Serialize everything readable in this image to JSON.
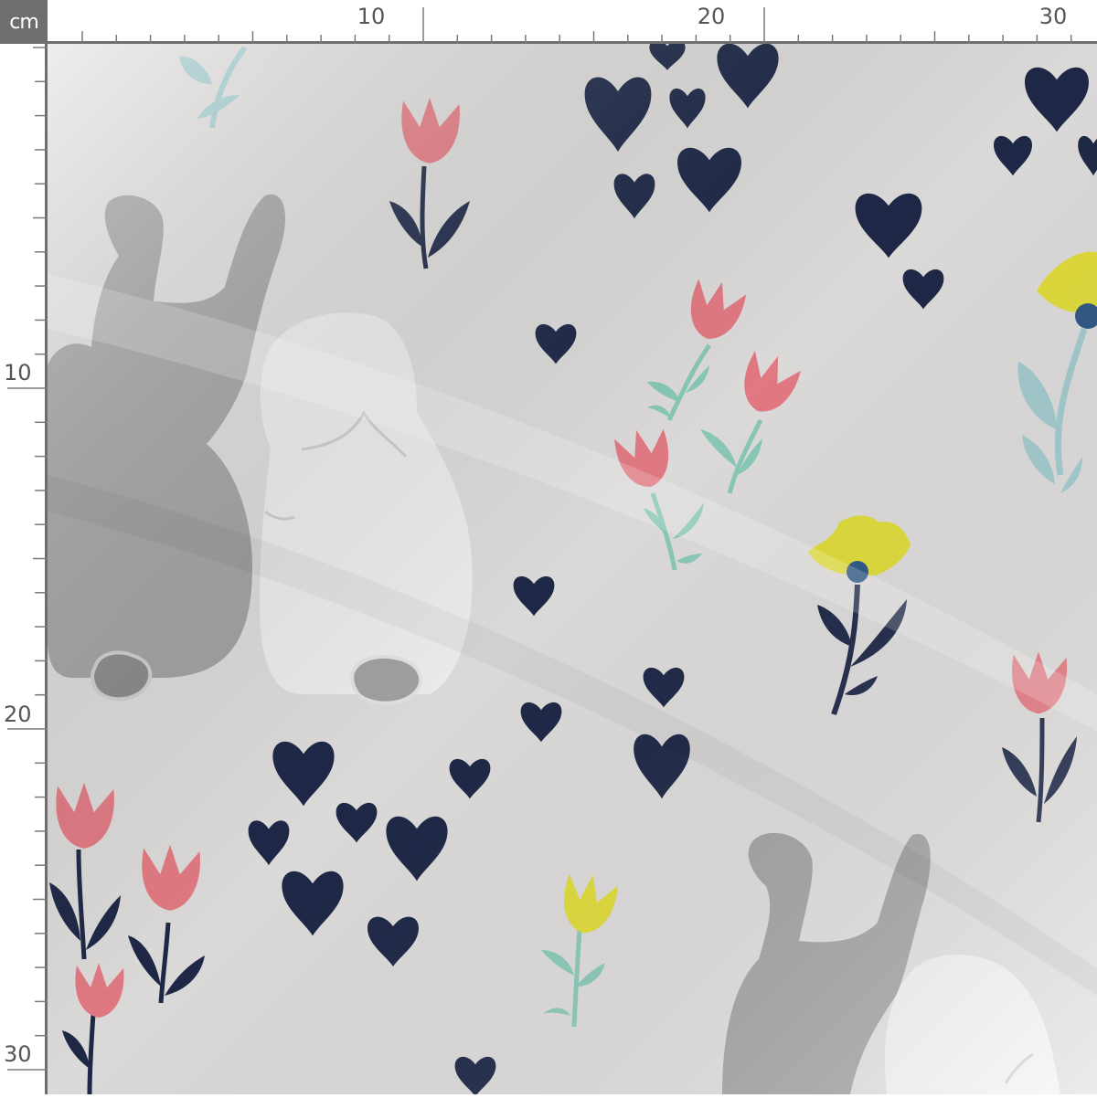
{
  "ruler": {
    "unit": "cm",
    "top_labels": [
      "10",
      "20",
      "30"
    ],
    "left_labels": [
      "10",
      "20",
      "30"
    ]
  },
  "fabric": {
    "motifs": [
      "bunny-pair",
      "heart-cluster",
      "tulip",
      "poppy",
      "leafy-sprig"
    ],
    "colors": {
      "background": "#e7e5e4",
      "gray_bunny": "#a9a8a7",
      "white_bunny": "#f7f7f6",
      "hearts_navy": "#1f2a4a",
      "tulip_pink": "#ec7f88",
      "poppy_yellow": "#e9e53c",
      "poppy_center": "#2f5b8a",
      "mint_leaf": "#8fd1bf",
      "aqua_leaf": "#a8d3d6"
    }
  }
}
